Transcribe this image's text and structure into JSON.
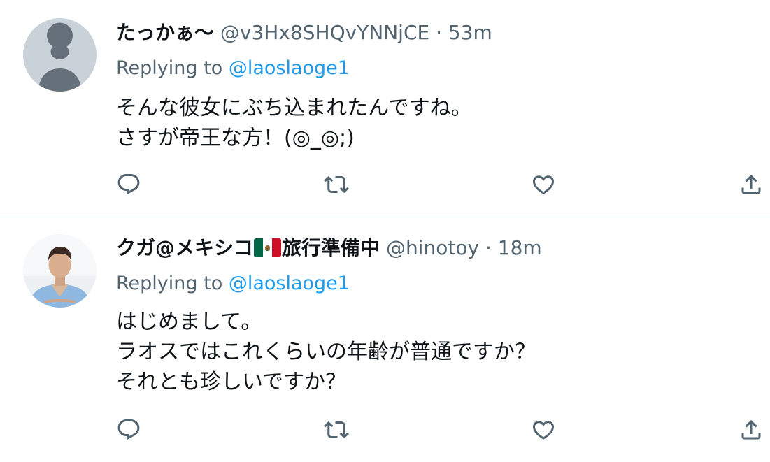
{
  "tweets": [
    {
      "display_name": "たっかぁ〜",
      "handle": "@v3Hx8SHQvYNNjCE",
      "separator": "·",
      "time": "53m",
      "replying_prefix": "Replying to",
      "replying_to": "@laoslaoge1",
      "body": [
        "そんな彼女にぶち込まれたんですね。",
        "さすが帝王な方！(◎_◎;)"
      ],
      "avatar": "default-profile-avatar"
    },
    {
      "display_name_part1": "クガ@メキシコ",
      "display_name_part2": "旅行準備中",
      "flag_icon": "mexico-flag-emoji",
      "handle": "@hinotoy",
      "separator": "·",
      "time": "18m",
      "replying_prefix": "Replying to",
      "replying_to": "@laoslaoge1",
      "body": [
        "はじめまして。",
        "ラオスではこれくらいの年齢が普通ですか？",
        "それとも珍しいですか？"
      ],
      "avatar": "man-light-blue-shirt-photo-avatar"
    }
  ],
  "action_icons": [
    "reply-icon",
    "retweet-icon",
    "like-icon",
    "share-icon"
  ],
  "colors": {
    "text_primary": "#0f1419",
    "text_secondary": "#536471",
    "link": "#1d9bf0",
    "divider": "#e6ecf0"
  }
}
